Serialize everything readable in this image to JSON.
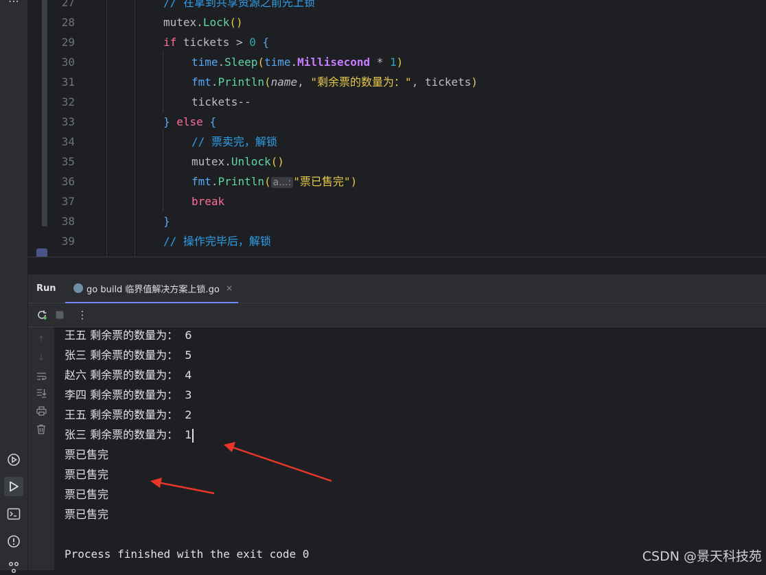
{
  "editor": {
    "lines": [
      {
        "num": "27",
        "indent": 2,
        "tokens": [
          {
            "t": "// 在拿到共享资源之前先上锁",
            "c": "cm"
          }
        ]
      },
      {
        "num": "28",
        "indent": 2,
        "tokens": [
          {
            "t": "mutex",
            "c": "pk"
          },
          {
            "t": ".",
            "c": "pk"
          },
          {
            "t": "Lock",
            "c": "fn"
          },
          {
            "t": "()",
            "c": "br1"
          }
        ]
      },
      {
        "num": "29",
        "indent": 2,
        "tokens": [
          {
            "t": "if",
            "c": "kw"
          },
          {
            "t": " tickets > ",
            "c": "pk"
          },
          {
            "t": "0",
            "c": "num"
          },
          {
            "t": " {",
            "c": "br3"
          }
        ]
      },
      {
        "num": "30",
        "indent": 3,
        "tokens": [
          {
            "t": "time",
            "c": "f"
          },
          {
            "t": ".",
            "c": "pk"
          },
          {
            "t": "Sleep",
            "c": "fn"
          },
          {
            "t": "(",
            "c": "br1"
          },
          {
            "t": "time",
            "c": "f"
          },
          {
            "t": ".",
            "c": "pk"
          },
          {
            "t": "Millisecond",
            "c": "const"
          },
          {
            "t": " * ",
            "c": "pk"
          },
          {
            "t": "1",
            "c": "num"
          },
          {
            "t": ")",
            "c": "br1"
          }
        ]
      },
      {
        "num": "31",
        "indent": 3,
        "tokens": [
          {
            "t": "fmt",
            "c": "f"
          },
          {
            "t": ".",
            "c": "pk"
          },
          {
            "t": "Println",
            "c": "fn"
          },
          {
            "t": "(",
            "c": "br1"
          },
          {
            "t": "name",
            "c": "it"
          },
          {
            "t": ", ",
            "c": "pk"
          },
          {
            "t": "\"剩余票的数量为：\"",
            "c": "str"
          },
          {
            "t": ", tickets",
            "c": "pk"
          },
          {
            "t": ")",
            "c": "br1"
          }
        ]
      },
      {
        "num": "32",
        "indent": 3,
        "tokens": [
          {
            "t": "tickets--",
            "c": "pk"
          }
        ]
      },
      {
        "num": "33",
        "indent": 2,
        "tokens": [
          {
            "t": "}",
            "c": "br3"
          },
          {
            "t": " else ",
            "c": "kw"
          },
          {
            "t": "{",
            "c": "br3"
          }
        ]
      },
      {
        "num": "34",
        "indent": 3,
        "tokens": [
          {
            "t": "// 票卖完，解锁",
            "c": "cm"
          }
        ]
      },
      {
        "num": "35",
        "indent": 3,
        "tokens": [
          {
            "t": "mutex",
            "c": "pk"
          },
          {
            "t": ".",
            "c": "pk"
          },
          {
            "t": "Unlock",
            "c": "fn"
          },
          {
            "t": "()",
            "c": "br1"
          }
        ]
      },
      {
        "num": "36",
        "indent": 3,
        "tokens": [
          {
            "t": "fmt",
            "c": "f"
          },
          {
            "t": ".",
            "c": "pk"
          },
          {
            "t": "Println",
            "c": "fn"
          },
          {
            "t": "(",
            "c": "br1"
          },
          {
            "t": "a...:",
            "c": "hint"
          },
          {
            "t": "\"票已售完\"",
            "c": "str"
          },
          {
            "t": ")",
            "c": "br1"
          }
        ]
      },
      {
        "num": "37",
        "indent": 3,
        "tokens": [
          {
            "t": "break",
            "c": "kw"
          }
        ]
      },
      {
        "num": "38",
        "indent": 2,
        "tokens": [
          {
            "t": "}",
            "c": "br3"
          }
        ]
      },
      {
        "num": "39",
        "indent": 2,
        "tokens": [
          {
            "t": "// 操作完毕后，解锁",
            "c": "cm"
          }
        ]
      }
    ]
  },
  "run_panel": {
    "run_label": "Run",
    "tab_label": "go build 临界值解决方案上锁.go",
    "close_glyph": "×",
    "more_glyph": "⋮"
  },
  "console": {
    "lines": [
      {
        "text": "王五 剩余票的数量为：  6"
      },
      {
        "text": "张三 剩余票的数量为：  5"
      },
      {
        "text": "赵六 剩余票的数量为：  4"
      },
      {
        "text": "李四 剩余票的数量为：  3"
      },
      {
        "text": "王五 剩余票的数量为：  2"
      },
      {
        "text": "张三 剩余票的数量为：  1"
      },
      {
        "text": "票已售完"
      },
      {
        "text": "票已售完"
      },
      {
        "text": "票已售完"
      },
      {
        "text": "票已售完"
      },
      {
        "text": ""
      },
      {
        "text": "Process finished with the exit code 0"
      }
    ]
  },
  "watermark": "CSDN @景天科技苑",
  "colors": {
    "annotation_arrow": "#e8362b",
    "tab_underline": "#6f8aff"
  }
}
